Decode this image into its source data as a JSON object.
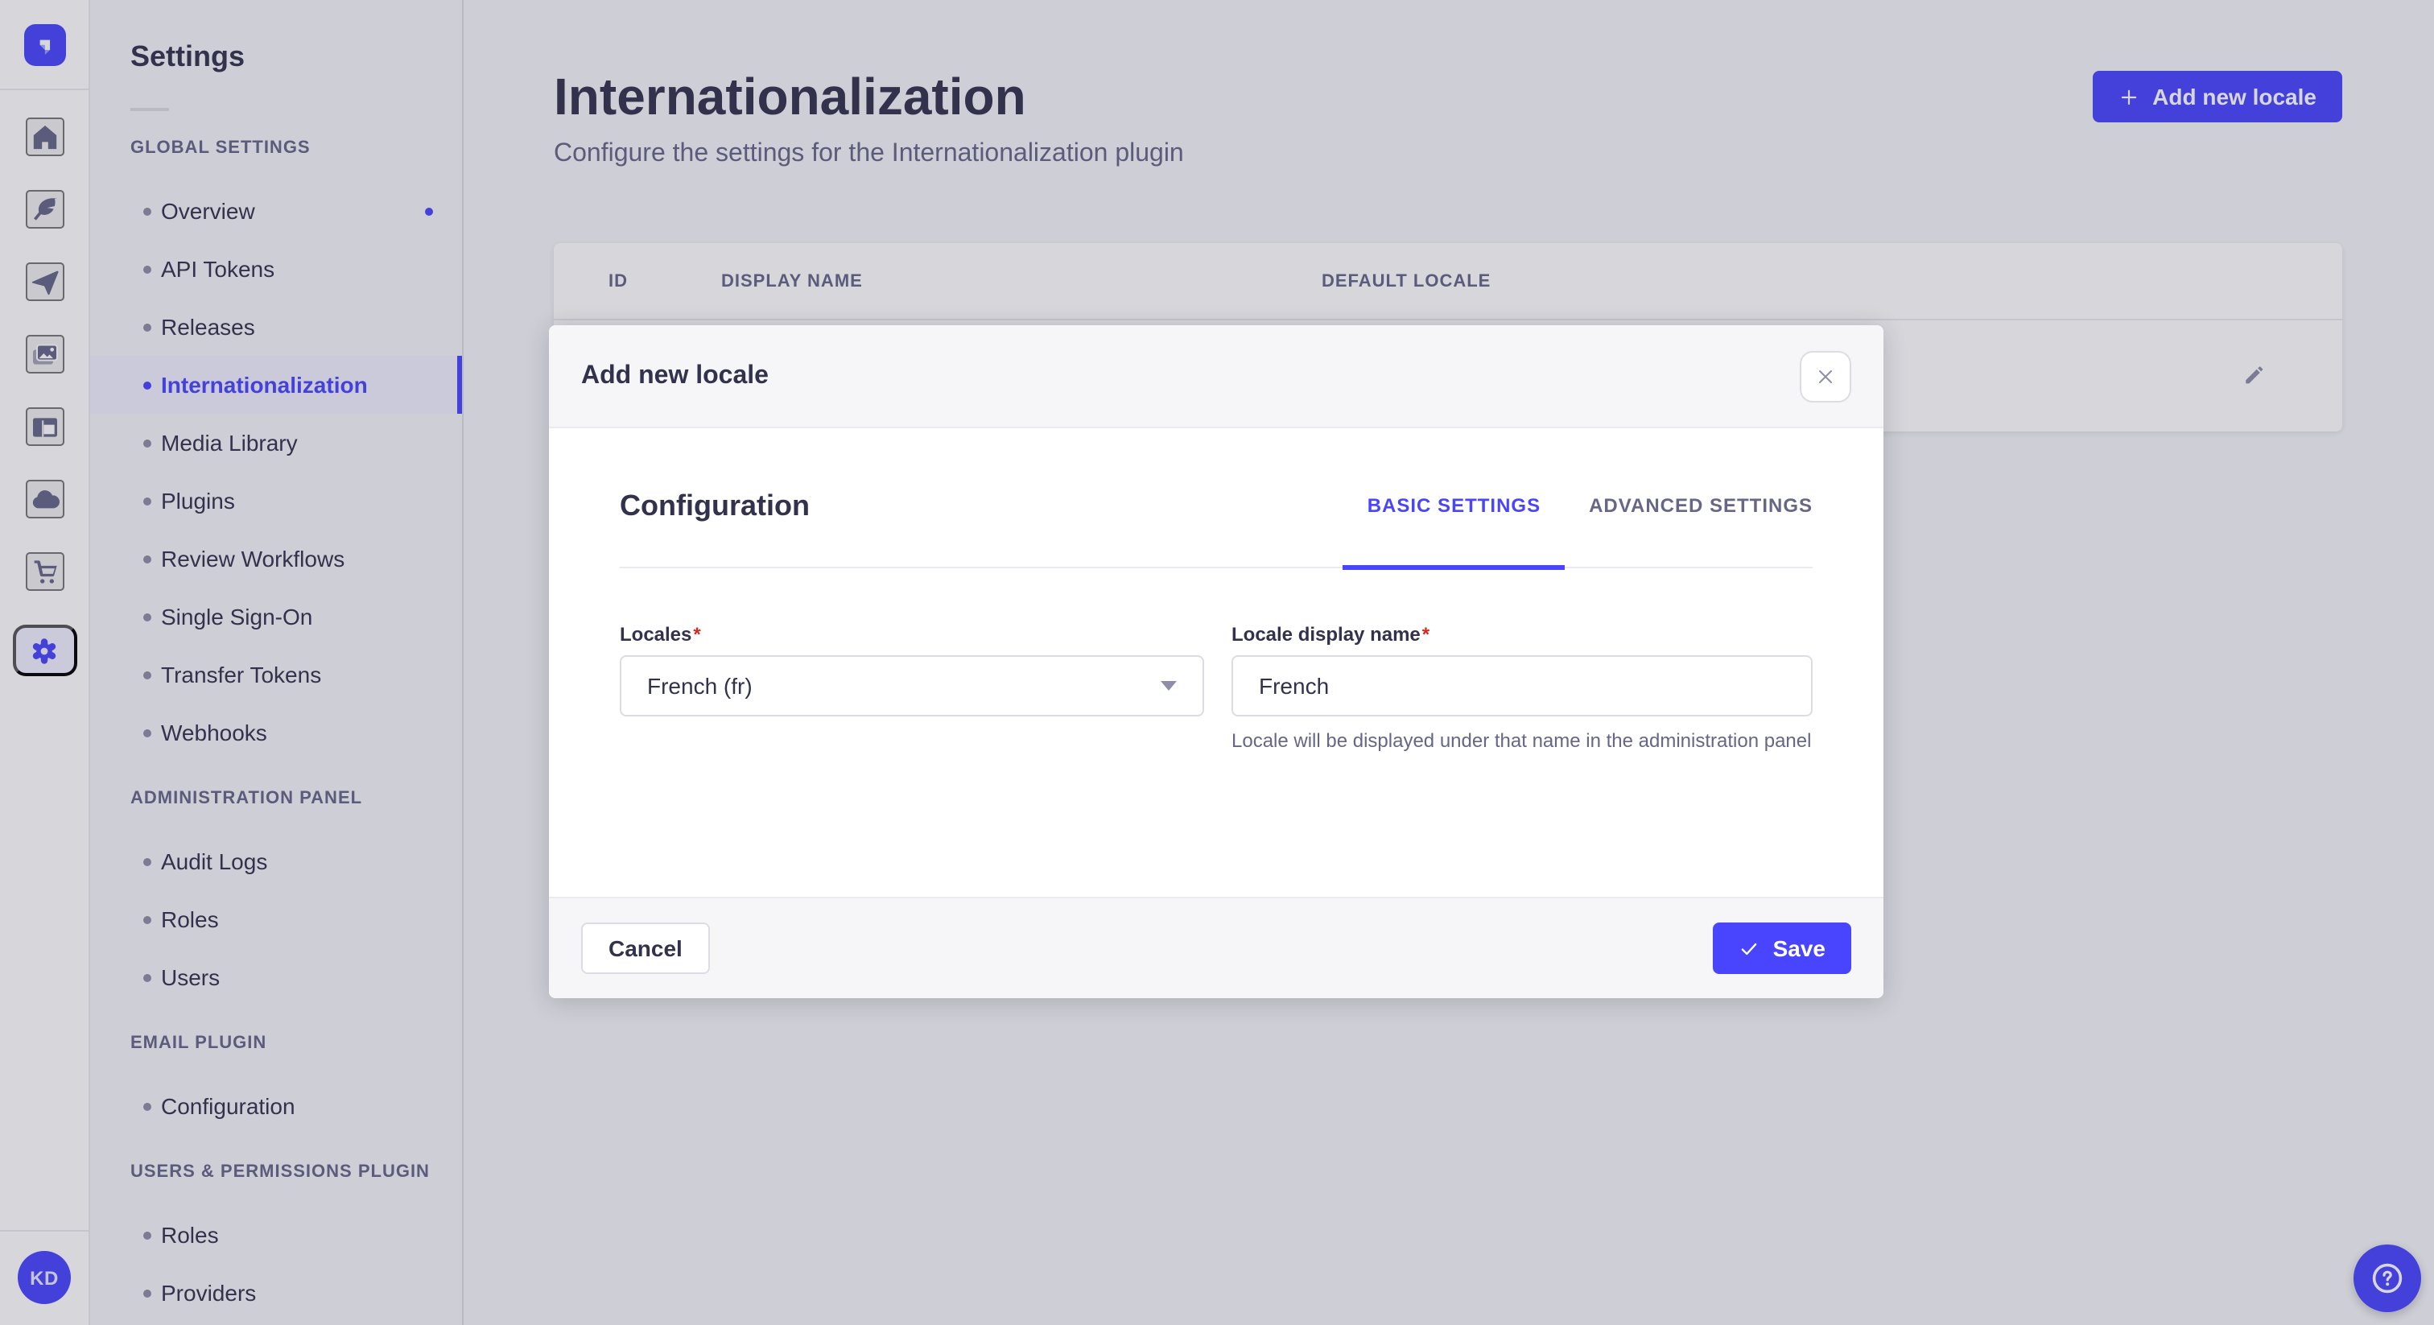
{
  "colors": {
    "primary": "#4945ff",
    "primary_light": "#f0f0ff",
    "text": "#32324d",
    "text_muted": "#666687",
    "icon_grey": "#8e8ea9",
    "border": "#dcdce4",
    "border_light": "#eaeaef",
    "surface": "#ffffff",
    "background": "#f6f6f9",
    "danger": "#d02b20"
  },
  "rail": {
    "logo_icon": "strapi-logo-icon",
    "icons": [
      "home-icon",
      "content-manager-icon",
      "send-icon",
      "media-library-icon",
      "content-type-builder-icon",
      "cloud-icon",
      "marketplace-cart-icon",
      "settings-gear-icon"
    ],
    "avatar_initials": "KD"
  },
  "sidebar": {
    "title": "Settings",
    "sections": [
      {
        "title": "GLOBAL SETTINGS",
        "items": [
          {
            "label": "Overview",
            "has_notification": true
          },
          {
            "label": "API Tokens"
          },
          {
            "label": "Releases"
          },
          {
            "label": "Internationalization",
            "active": true
          },
          {
            "label": "Media Library"
          },
          {
            "label": "Plugins"
          },
          {
            "label": "Review Workflows"
          },
          {
            "label": "Single Sign-On"
          },
          {
            "label": "Transfer Tokens"
          },
          {
            "label": "Webhooks"
          }
        ]
      },
      {
        "title": "ADMINISTRATION PANEL",
        "items": [
          {
            "label": "Audit Logs"
          },
          {
            "label": "Roles"
          },
          {
            "label": "Users"
          }
        ]
      },
      {
        "title": "EMAIL PLUGIN",
        "items": [
          {
            "label": "Configuration"
          }
        ]
      },
      {
        "title": "USERS & PERMISSIONS PLUGIN",
        "items": [
          {
            "label": "Roles"
          },
          {
            "label": "Providers"
          }
        ]
      }
    ]
  },
  "page": {
    "title": "Internationalization",
    "subtitle": "Configure the settings for the Internationalization plugin",
    "add_button_label": "Add new locale"
  },
  "table": {
    "columns": [
      "ID",
      "DISPLAY NAME",
      "DEFAULT LOCALE"
    ]
  },
  "modal": {
    "title": "Add new locale",
    "section_title": "Configuration",
    "tabs": [
      {
        "label": "BASIC SETTINGS",
        "active": true
      },
      {
        "label": "ADVANCED SETTINGS",
        "active": false
      }
    ],
    "fields": {
      "locales": {
        "label": "Locales",
        "required": "*",
        "value": "French (fr)"
      },
      "display_name": {
        "label": "Locale display name",
        "required": "*",
        "value": "French",
        "hint": "Locale will be displayed under that name in the administration panel"
      }
    },
    "footer": {
      "cancel_label": "Cancel",
      "save_label": "Save"
    }
  }
}
